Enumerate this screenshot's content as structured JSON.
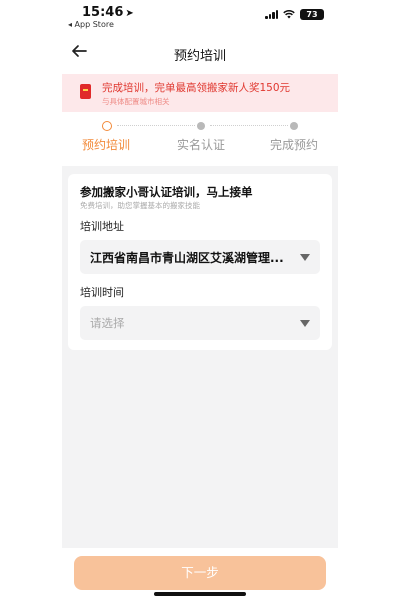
{
  "status_bar": {
    "time": "15:46",
    "location_arrow": "➤",
    "back_to_app": "◂ App Store",
    "battery": "73"
  },
  "nav": {
    "title": "预约培训",
    "back_icon": "arrow-left-icon"
  },
  "promo": {
    "main_text": "完成培训，完单最高领搬家新人奖150元",
    "sub_text": "与具体配置城市相关",
    "icon": "red-packet-icon",
    "bg_color": "#fde8ea",
    "text_color": "#e0372f"
  },
  "steps": [
    {
      "label": "预约培训",
      "active": true
    },
    {
      "label": "实名认证",
      "active": false
    },
    {
      "label": "完成预约",
      "active": false
    }
  ],
  "card": {
    "title": "参加搬家小哥认证培训，马上接单",
    "subtitle": "免费培训，助您掌握基本的搬家技能",
    "address": {
      "label": "培训地址",
      "value": "江西省南昌市青山湖区艾溪湖管理..."
    },
    "time": {
      "label": "培训时间",
      "placeholder": "请选择"
    }
  },
  "footer": {
    "next_label": "下一步",
    "button_color": "#f8c29a"
  },
  "colors": {
    "accent": "#f28a3a"
  }
}
